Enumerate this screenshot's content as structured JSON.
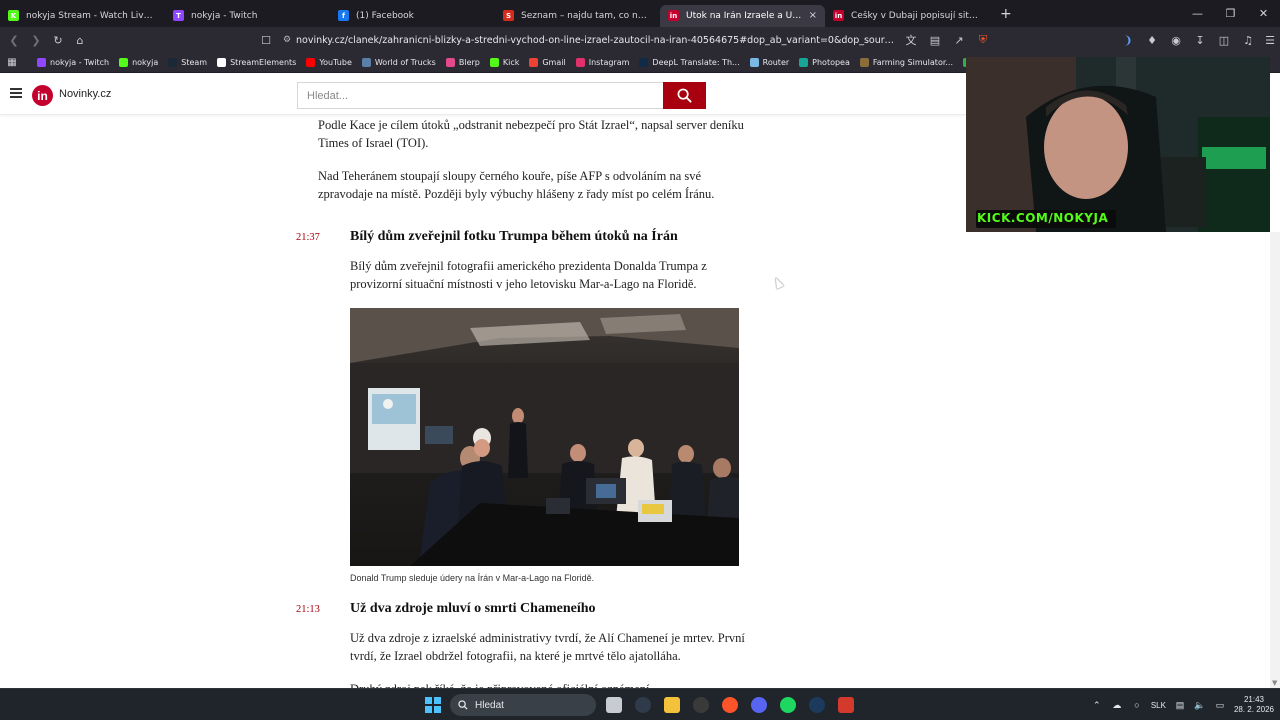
{
  "browser": {
    "tabs": [
      {
        "title": "nokyja Stream - Watch Live on Kick",
        "favicon_color": "#53fc18",
        "favicon_glyph": "K",
        "active": false
      },
      {
        "title": "nokyja - Twitch",
        "favicon_color": "#9146ff",
        "favicon_glyph": "T",
        "active": false
      },
      {
        "title": "(1) Facebook",
        "favicon_color": "#1877f2",
        "favicon_glyph": "f",
        "active": false
      },
      {
        "title": "Seznam – najdu tam, co neznám",
        "favicon_color": "#d52b1e",
        "favicon_glyph": "S",
        "active": false
      },
      {
        "title": "Útok na Írán Izraele a USA: Válka",
        "favicon_color": "#c4002f",
        "favicon_glyph": "in",
        "active": true
      },
      {
        "title": "Češky v Dubaji popisují situaci po úto",
        "favicon_color": "#c4002f",
        "favicon_glyph": "in",
        "active": false
      }
    ],
    "close_glyph": "×",
    "new_tab_glyph": "+",
    "url": "novinky.cz/clanek/zahranicni-blizky-a-stredni-vychod-on-line-izrael-zautocil-na-iran-40564675#dop_ab_variant=0&dop_source_zone_name=n...",
    "bookmarks": [
      {
        "label": "nokyja - Twitch",
        "color": "#9146ff"
      },
      {
        "label": "nokyja",
        "color": "#53fc18"
      },
      {
        "label": "Steam",
        "color": "#1b2838"
      },
      {
        "label": "StreamElements",
        "color": "#ffffff"
      },
      {
        "label": "YouTube",
        "color": "#ff0000"
      },
      {
        "label": "World of Trucks",
        "color": "#5a7fa8"
      },
      {
        "label": "Blerp",
        "color": "#e4498b"
      },
      {
        "label": "Kick",
        "color": "#53fc18"
      },
      {
        "label": "Gmail",
        "color": "#ea4335"
      },
      {
        "label": "Instagram",
        "color": "#e1306c"
      },
      {
        "label": "DeepL Translate: Th...",
        "color": "#0f2b46"
      },
      {
        "label": "Router",
        "color": "#7ab8e6"
      },
      {
        "label": "Photopea",
        "color": "#18a497"
      },
      {
        "label": "Farming Simulator...",
        "color": "#8a6d3b"
      },
      {
        "label": "Ko",
        "color": "#2bb24c"
      }
    ]
  },
  "site": {
    "name": "Novinky.cz",
    "logo_text": "in",
    "brand_color": "#c4002f",
    "search_placeholder": "Hledat..."
  },
  "article": {
    "paragraphs_top": [
      "Podle Kace je cílem útoků „odstranit nebezpečí pro Stát Izrael“, napsal server deníku Times of Israel (TOI).",
      "Nad Teheránem stoupají sloupy černého kouře, píše AFP s odvoláním na své zpravodaje na místě. Později byly výbuchy hlášeny z řady míst po celém Íránu."
    ],
    "entries": [
      {
        "time": "21:37",
        "heading": "Bílý dům zveřejnil fotku Trumpa během útoků na Írán",
        "body": "Bílý dům zveřejnil fotografii amerického prezidenta Donalda Trumpa z provizorní situační místnosti v jeho letovisku Mar-a-Lago na Floridě.",
        "photo_caption": "Donald Trump sleduje údery na Írán v Mar-a-Lago na Floridě."
      },
      {
        "time": "21:13",
        "heading": "Už dva zdroje mluví o smrti Chameneího",
        "body": "Už dva zdroje z izraelské administrativy tvrdí, že Alí Chameneí je mrtev. První tvrdí, že Izrael obdržel fotografii, na které je mrtvé tělo ajatolláha.",
        "body_cut": "Druhý zdroj pak říká, že je připravované oficiální oznámení."
      }
    ]
  },
  "overlay": {
    "webcam_tag": "KICK.COM/NOKYJA"
  },
  "taskbar": {
    "search_placeholder": "Hledat",
    "language": "SLK",
    "time": "21:43",
    "date": "28. 2. 2026",
    "apps": [
      {
        "name": "task-view",
        "color": "#c8ccd2"
      },
      {
        "name": "app-circle",
        "color": "#2f3a4a"
      },
      {
        "name": "file-explorer",
        "color": "#f3c13a"
      },
      {
        "name": "obs",
        "color": "#3a3a3a"
      },
      {
        "name": "brave",
        "color": "#fb542b"
      },
      {
        "name": "discord",
        "color": "#5865f2"
      },
      {
        "name": "spotify",
        "color": "#1ed760"
      },
      {
        "name": "steam",
        "color": "#1b3a5c"
      },
      {
        "name": "app-red",
        "color": "#d33a2c"
      }
    ]
  }
}
